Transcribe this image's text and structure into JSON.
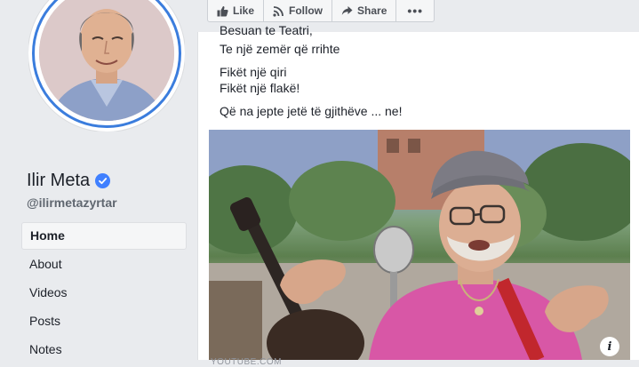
{
  "colors": {
    "background": "#e9ebee",
    "brand_blue": "#4080ff",
    "ring_blue": "#3b7ddd"
  },
  "actions": [
    {
      "label": "Like",
      "icon": "thumbs-up-icon"
    },
    {
      "label": "Follow",
      "icon": "rss-icon"
    },
    {
      "label": "Share",
      "icon": "share-icon"
    },
    {
      "label": "",
      "icon": "more-icon"
    }
  ],
  "profile": {
    "name": "Ilir Meta",
    "handle": "@ilirmetazyrtar",
    "verified_icon": "verified-badge-icon"
  },
  "nav": {
    "items": [
      {
        "label": "Home",
        "active": true
      },
      {
        "label": "About",
        "active": false
      },
      {
        "label": "Videos",
        "active": false
      },
      {
        "label": "Posts",
        "active": false
      },
      {
        "label": "Notes",
        "active": false
      }
    ]
  },
  "post": {
    "clipped_line": "Besuan te Teatri,",
    "lines": [
      "Te një zemër që rrihte",
      "Fikët një qiri",
      "Fikët një flakë!",
      "Që na jepte jetë të gjithëve ... ne!"
    ],
    "media_info_icon": "info-icon",
    "source_label": "YOUTUBE.COM"
  }
}
